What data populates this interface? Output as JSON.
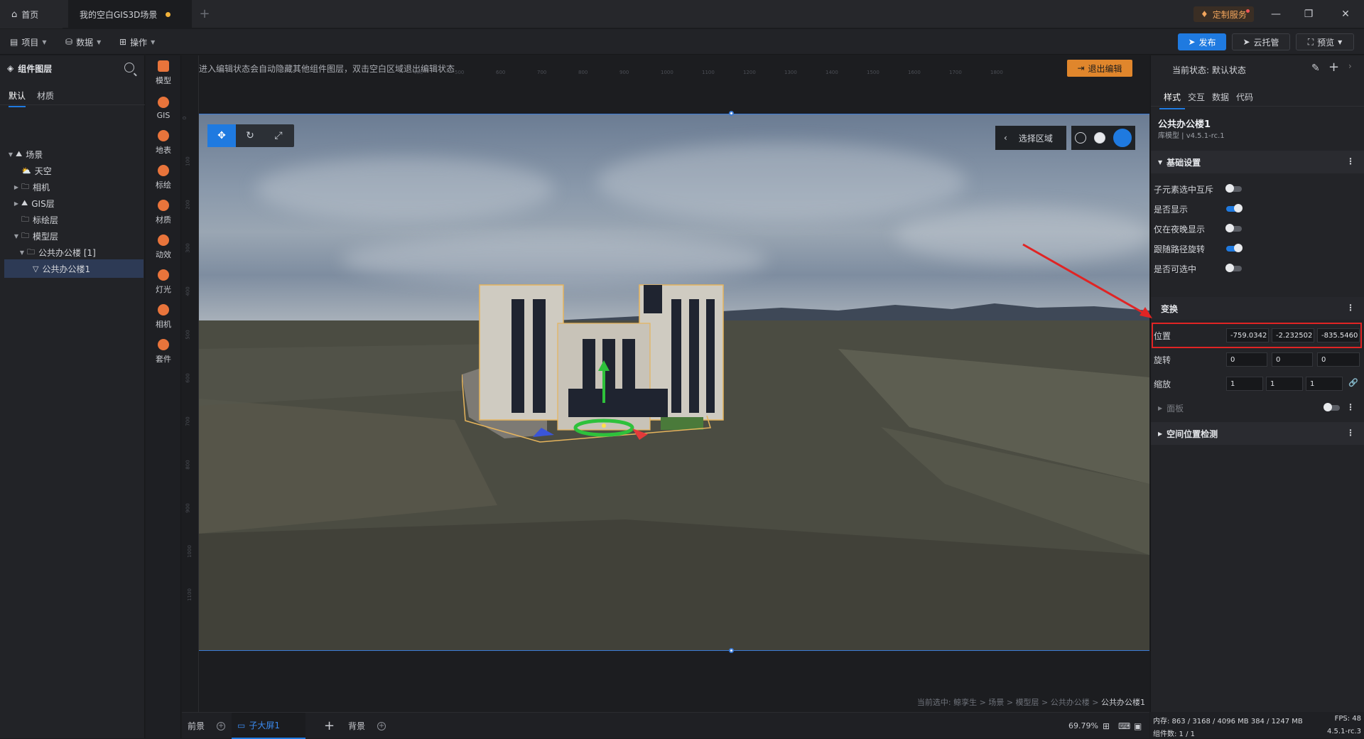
{
  "titlebar": {
    "home_tab": "首页",
    "active_tab": "我的空白GIS3D场景",
    "custom_service": "定制服务",
    "add_tab": "+"
  },
  "menubar": {
    "project": "项目",
    "data": "数据",
    "operation": "操作",
    "publish": "发布",
    "cloud_host": "云托管",
    "preview": "预览"
  },
  "left_panel": {
    "title": "组件图层",
    "tabs": [
      "默认",
      "材质"
    ],
    "tree": [
      {
        "label": "场景",
        "level": 0,
        "expanded": true
      },
      {
        "label": "天空",
        "level": 1
      },
      {
        "label": "相机",
        "level": 1,
        "expandable": true
      },
      {
        "label": "GIS层",
        "level": 1,
        "expandable": true
      },
      {
        "label": "标绘层",
        "level": 1
      },
      {
        "label": "模型层",
        "level": 1,
        "expanded": true
      },
      {
        "label": "公共办公楼 [1]",
        "level": 2,
        "expanded": true
      },
      {
        "label": "公共办公楼1",
        "level": 3,
        "selected": true
      }
    ]
  },
  "tools": [
    "模型",
    "GIS",
    "地表",
    "标绘",
    "材质",
    "动效",
    "灯光",
    "相机",
    "套件"
  ],
  "canvas": {
    "hint": "进入编辑状态会自动隐藏其他组件图层，双击空白区域退出编辑状态",
    "exit_edit": "退出编辑",
    "select_region": "选择区域",
    "breadcrumb_prefix": "当前选中:",
    "breadcrumb": [
      "鲸孪生",
      "场景",
      "模型层",
      "公共办公楼"
    ],
    "breadcrumb_last": "公共办公楼1",
    "ruler_top": [
      "400",
      "500",
      "600",
      "700",
      "800",
      "900",
      "1000",
      "1100",
      "1200",
      "1300",
      "1400",
      "1500",
      "1600",
      "1700",
      "1800"
    ],
    "ruler_left": [
      "0",
      "100",
      "200",
      "300",
      "400",
      "500",
      "600",
      "700",
      "800",
      "900",
      "1000",
      "1100"
    ]
  },
  "bottombar": {
    "foreground": "前景",
    "sub_screen": "子大屏1",
    "background": "背景",
    "zoom": "69.79%"
  },
  "right_panel": {
    "state_label": "当前状态:",
    "state_value": "默认状态",
    "tabs": [
      "样式",
      "交互",
      "数据",
      "代码"
    ],
    "component_name": "公共办公楼1",
    "component_sub": "库模型 | v4.5.1-rc.1",
    "basic_section": "基础设置",
    "toggles": [
      {
        "label": "子元素选中互斥",
        "on": false
      },
      {
        "label": "是否显示",
        "on": true
      },
      {
        "label": "仅在夜晚显示",
        "on": false
      },
      {
        "label": "跟随路径旋转",
        "on": true
      },
      {
        "label": "是否可选中",
        "on": false
      }
    ],
    "transform_section": "变换",
    "position_label": "位置",
    "position": [
      "-759.0342",
      "-2.232502",
      "-835.5460"
    ],
    "rotation_label": "旋转",
    "rotation": [
      "0",
      "0",
      "0"
    ],
    "scale_label": "缩放",
    "scale": [
      "1",
      "1",
      "1"
    ],
    "panel_section": "面板",
    "spatial_section": "空间位置检测"
  },
  "status": {
    "memory": "内存: 863 / 3168 / 4096 MB  384 / 1247 MB",
    "fps": "FPS: 48",
    "components": "组件数: 1 / 1",
    "version": "4.5.1-rc.3"
  }
}
